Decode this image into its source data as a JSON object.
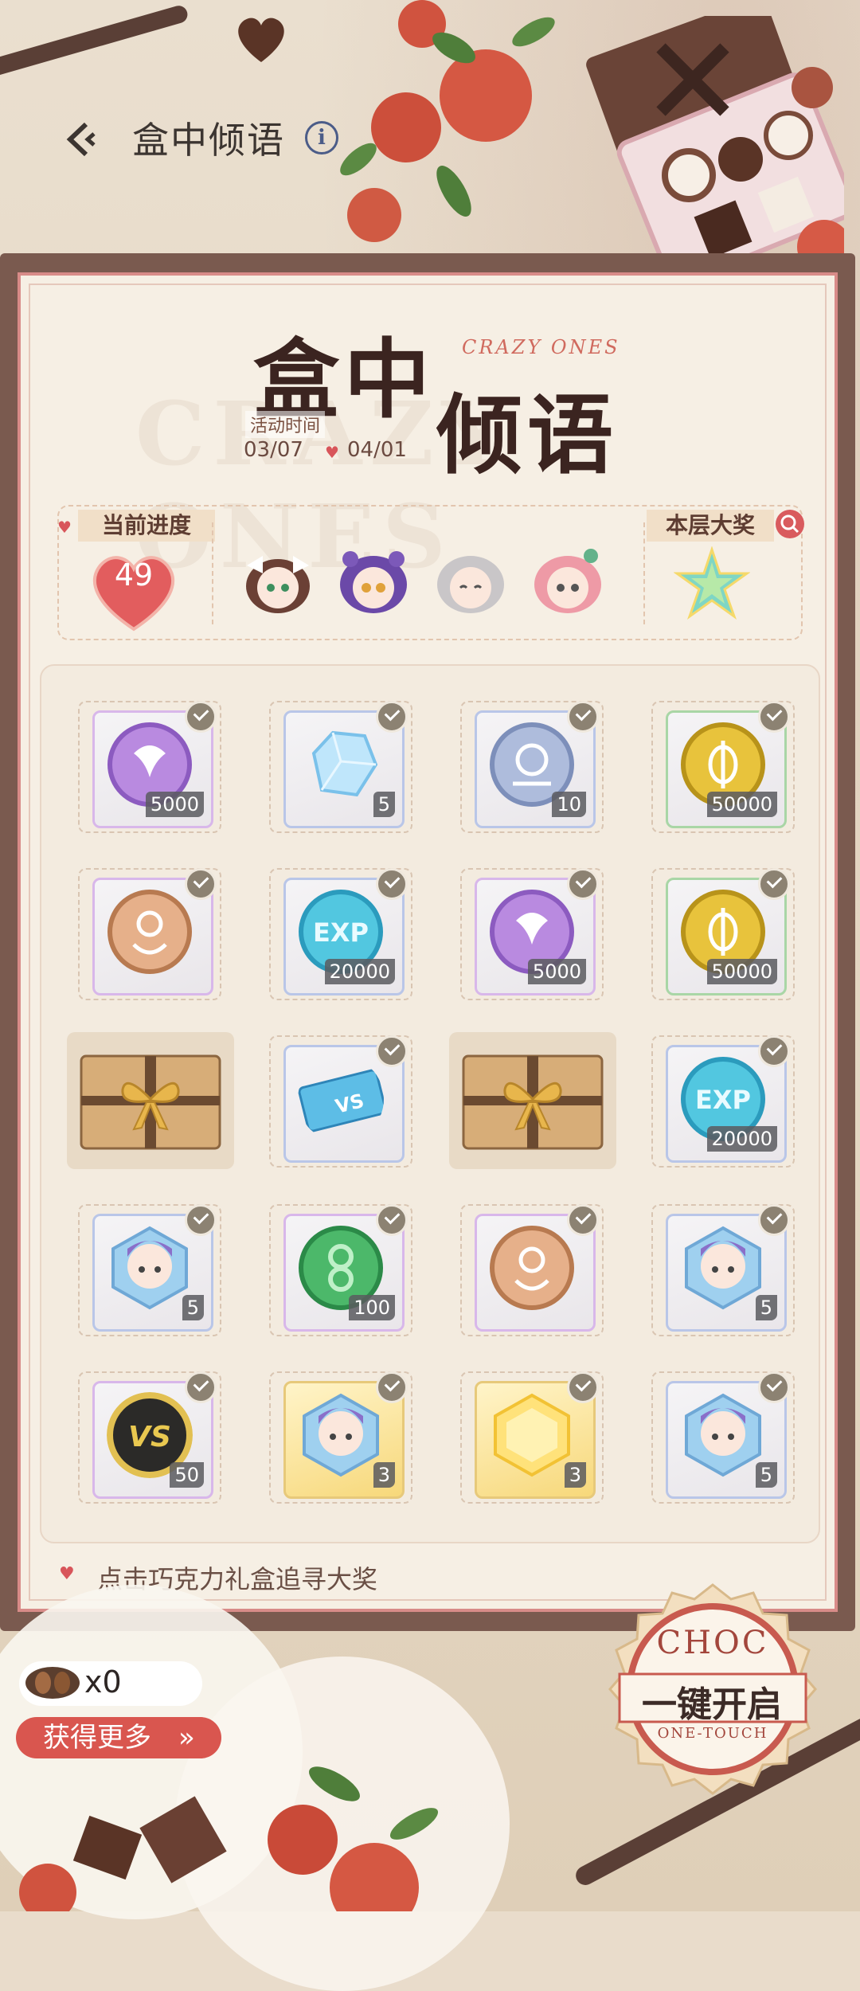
{
  "header": {
    "title": "盒中倾语",
    "info_icon": "info-icon",
    "back_icon": "back-arrow-icon"
  },
  "event": {
    "logo_line1": "盒中",
    "logo_line2": "倾语",
    "subtitle": "CRAZY ONES",
    "time_label": "活动时间",
    "start_date": "03/07",
    "end_date": "04/01"
  },
  "progress": {
    "label": "当前进度",
    "value": "49",
    "characters": [
      "char-1",
      "char-2",
      "char-3",
      "char-4"
    ]
  },
  "grand_prize": {
    "label": "本层大奖",
    "icon": "star-crystal-icon"
  },
  "rewards": [
    [
      {
        "icon": "purple-coin-icon",
        "qty": "5000",
        "claimed": true,
        "card": "purple"
      },
      {
        "icon": "blue-crystal-icon",
        "qty": "5",
        "claimed": true,
        "card": "blue"
      },
      {
        "icon": "silver-medal-icon",
        "qty": "10",
        "claimed": true,
        "card": "blue"
      },
      {
        "icon": "gold-coin-icon",
        "qty": "50000",
        "claimed": true,
        "card": "green"
      }
    ],
    [
      {
        "icon": "bronze-medal-icon",
        "qty": "",
        "claimed": true,
        "card": "purple"
      },
      {
        "icon": "exp-coin-icon",
        "qty": "20000",
        "claimed": true,
        "card": "blue"
      },
      {
        "icon": "purple-coin-icon",
        "qty": "5000",
        "claimed": true,
        "card": "purple"
      },
      {
        "icon": "gold-coin-icon",
        "qty": "50000",
        "claimed": true,
        "card": "green"
      }
    ],
    [
      {
        "icon": "gift-box-icon",
        "qty": "",
        "claimed": false,
        "card": "gift"
      },
      {
        "icon": "vs-ticket-icon",
        "qty": "",
        "claimed": true,
        "card": "blue"
      },
      {
        "icon": "gift-box-icon",
        "qty": "",
        "claimed": false,
        "card": "gift"
      },
      {
        "icon": "exp-coin-icon",
        "qty": "20000",
        "claimed": true,
        "card": "blue"
      }
    ],
    [
      {
        "icon": "character-shard-icon",
        "qty": "5",
        "claimed": true,
        "card": "blue"
      },
      {
        "icon": "green-coin-icon",
        "qty": "100",
        "claimed": true,
        "card": "purple"
      },
      {
        "icon": "bronze-medal-icon",
        "qty": "",
        "claimed": true,
        "card": "purple"
      },
      {
        "icon": "character-shard-icon",
        "qty": "5",
        "claimed": true,
        "card": "blue"
      }
    ],
    [
      {
        "icon": "vs-coin-icon",
        "qty": "50",
        "claimed": true,
        "card": "purple"
      },
      {
        "icon": "character-shard-icon",
        "qty": "3",
        "claimed": true,
        "card": "gold"
      },
      {
        "icon": "gold-shard-icon",
        "qty": "3",
        "claimed": true,
        "card": "gold"
      },
      {
        "icon": "character-shard-icon",
        "qty": "5",
        "claimed": true,
        "card": "blue"
      }
    ]
  ],
  "hint": "点击巧克力礼盒追寻大奖",
  "currency": {
    "count": "x0",
    "icon": "cocoa-beans-icon"
  },
  "get_more": {
    "label": "获得更多",
    "arrow": "»"
  },
  "one_touch": {
    "badge_top": "CHOC",
    "label": "一键开启",
    "badge_bottom": "ONE-TOUCH"
  },
  "colors": {
    "accent": "#d9564f",
    "panel_border": "#d88b88",
    "dark_brown": "#3b2420"
  }
}
